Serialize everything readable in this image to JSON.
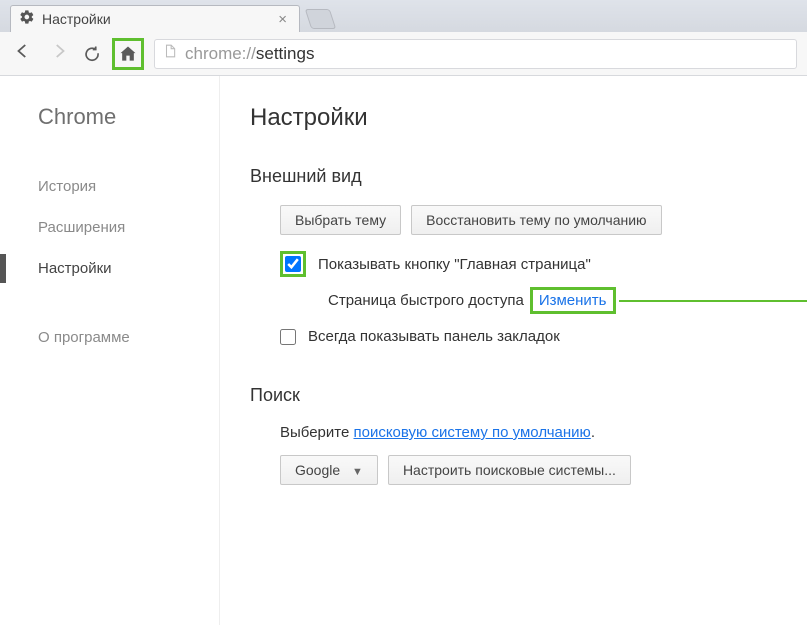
{
  "tab": {
    "title": "Настройки"
  },
  "url": {
    "proto": "chrome://",
    "path": "settings"
  },
  "sidebar": {
    "brand": "Chrome",
    "items": [
      "История",
      "Расширения",
      "Настройки"
    ],
    "about": "О программе",
    "active_index": 2
  },
  "main": {
    "title": "Настройки",
    "appearance": {
      "heading": "Внешний вид",
      "choose_theme": "Выбрать тему",
      "restore_default": "Восстановить тему по умолчанию",
      "show_home_btn": "Показывать кнопку \"Главная страница\"",
      "quick_access": "Страница быстрого доступа",
      "change_link": "Изменить",
      "show_bookmarks": "Всегда показывать панель закладок"
    },
    "search": {
      "heading": "Поиск",
      "desc_prefix": "Выберите ",
      "desc_link": "поисковую систему по умолчанию",
      "engine": "Google",
      "configure": "Настроить поисковые системы..."
    }
  }
}
